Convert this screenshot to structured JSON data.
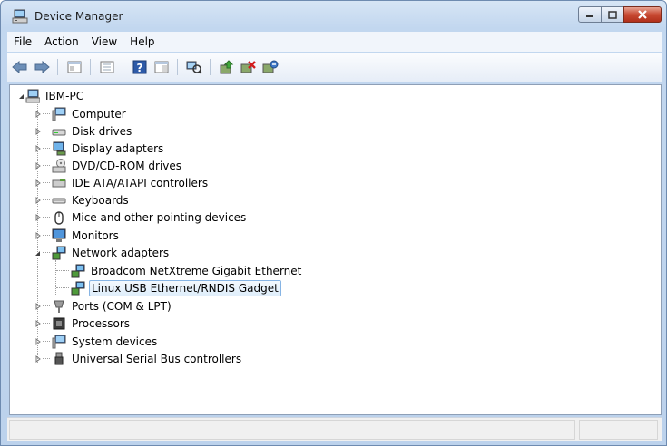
{
  "window": {
    "title": "Device Manager"
  },
  "menu": [
    "File",
    "Action",
    "View",
    "Help"
  ],
  "toolbar": [
    "back-icon",
    "forward-icon",
    "sep",
    "properties-panel-icon",
    "sep",
    "console-tree-icon",
    "sep",
    "help-icon",
    "show-hide-icon",
    "sep",
    "scan-hardware-icon",
    "sep",
    "update-driver-icon",
    "disable-device-icon",
    "uninstall-device-icon"
  ],
  "tree": {
    "root": "IBM-PC",
    "categories": [
      {
        "label": "Computer",
        "icon": "computer-icon",
        "expanded": false
      },
      {
        "label": "Disk drives",
        "icon": "disk-drive-icon",
        "expanded": false
      },
      {
        "label": "Display adapters",
        "icon": "display-adapter-icon",
        "expanded": false
      },
      {
        "label": "DVD/CD-ROM drives",
        "icon": "dvd-drive-icon",
        "expanded": false
      },
      {
        "label": "IDE ATA/ATAPI controllers",
        "icon": "ide-controller-icon",
        "expanded": false
      },
      {
        "label": "Keyboards",
        "icon": "keyboard-icon",
        "expanded": false
      },
      {
        "label": "Mice and other pointing devices",
        "icon": "mouse-icon",
        "expanded": false
      },
      {
        "label": "Monitors",
        "icon": "monitor-icon",
        "expanded": false
      },
      {
        "label": "Network adapters",
        "icon": "network-adapter-icon",
        "expanded": true,
        "children": [
          {
            "label": "Broadcom NetXtreme Gigabit Ethernet",
            "icon": "network-adapter-icon",
            "selected": false
          },
          {
            "label": "Linux USB Ethernet/RNDIS Gadget",
            "icon": "network-adapter-icon",
            "selected": true
          }
        ]
      },
      {
        "label": "Ports (COM & LPT)",
        "icon": "port-icon",
        "expanded": false
      },
      {
        "label": "Processors",
        "icon": "processor-icon",
        "expanded": false
      },
      {
        "label": "System devices",
        "icon": "system-device-icon",
        "expanded": false
      },
      {
        "label": "Universal Serial Bus controllers",
        "icon": "usb-icon",
        "expanded": false
      }
    ]
  },
  "status": {
    "text": ""
  }
}
